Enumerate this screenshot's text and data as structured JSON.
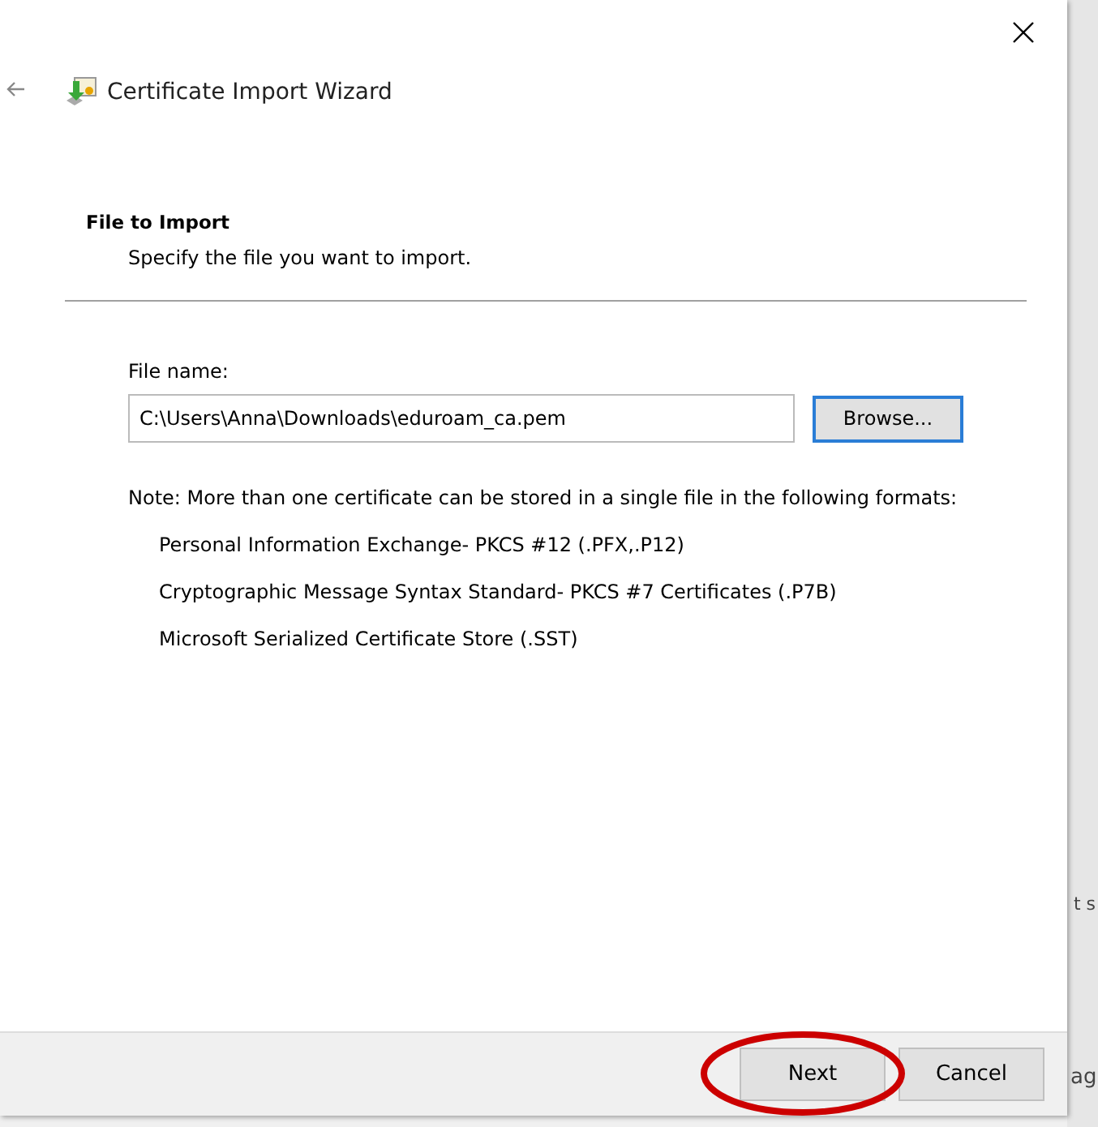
{
  "window": {
    "title": "Certificate Import Wizard"
  },
  "page": {
    "heading": "File to Import",
    "subtitle": "Specify the file you want to import."
  },
  "file_field": {
    "label": "File name:",
    "value": "C:\\Users\\Anna\\Downloads\\eduroam_ca.pem"
  },
  "browse_button": "Browse...",
  "note": "Note:  More than one certificate can be stored in a single file in the following formats:",
  "formats": [
    "Personal Information Exchange- PKCS #12 (.PFX,.P12)",
    "Cryptographic Message Syntax Standard- PKCS #7 Certificates (.P7B)",
    "Microsoft Serialized Certificate Store (.SST)"
  ],
  "buttons": [
    {
      "label": "Next",
      "highlighted": true
    },
    {
      "label": "Cancel",
      "highlighted": false
    }
  ],
  "background_texts": [
    "t s",
    "ag"
  ]
}
